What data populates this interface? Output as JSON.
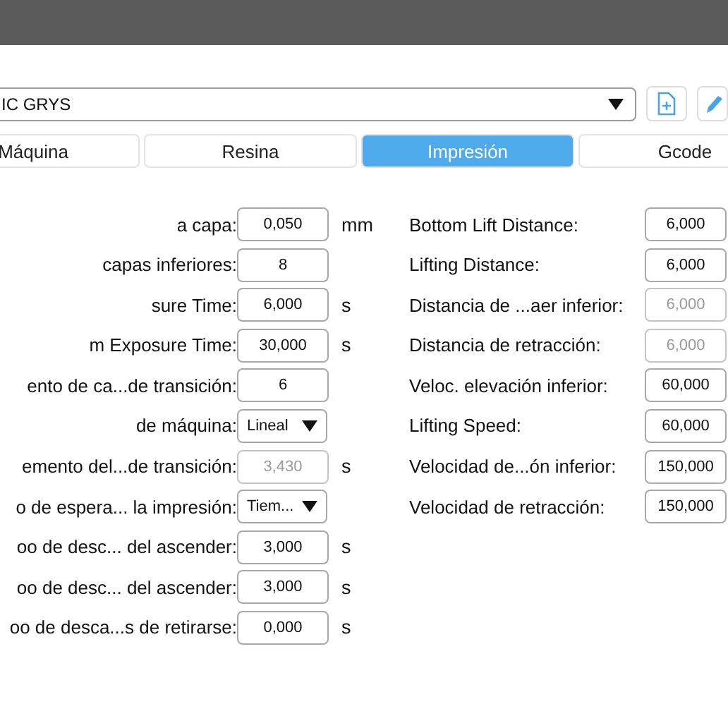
{
  "profile": {
    "value": "IC GRYS"
  },
  "tabs": [
    {
      "label": "Máquina",
      "selected": false
    },
    {
      "label": "Resina",
      "selected": false
    },
    {
      "label": "Impresión",
      "selected": true
    },
    {
      "label": "Gcode",
      "selected": false
    }
  ],
  "left_fields": [
    {
      "label": "a capa:",
      "kind": "input",
      "value": "0,050",
      "unit": "mm",
      "disabled": false
    },
    {
      "label": "capas inferiores:",
      "kind": "input",
      "value": "8",
      "disabled": false
    },
    {
      "label": "sure Time:",
      "kind": "input",
      "value": "6,000",
      "unit": "s",
      "disabled": false
    },
    {
      "label": "m Exposure Time:",
      "kind": "input",
      "value": "30,000",
      "unit": "s",
      "disabled": false
    },
    {
      "label": "ento de ca...de transición:",
      "kind": "input",
      "value": "6",
      "disabled": false
    },
    {
      "label": "de máquina:",
      "kind": "select",
      "value": "Lineal",
      "disabled": false
    },
    {
      "label": "emento del...de transición:",
      "kind": "input",
      "value": "3,430",
      "unit": "s",
      "disabled": true
    },
    {
      "label": "o de espera... la impresión:",
      "kind": "select",
      "value": "Tiem...",
      "disabled": false
    },
    {
      "label": "oo de desc... del ascender:",
      "kind": "input",
      "value": "3,000",
      "unit": "s",
      "disabled": false
    },
    {
      "label": "oo de desc... del ascender:",
      "kind": "input",
      "value": "3,000",
      "unit": "s",
      "disabled": false
    },
    {
      "label": "oo de desca...s de retirarse:",
      "kind": "input",
      "value": "0,000",
      "unit": "s",
      "disabled": false
    }
  ],
  "right_fields": [
    {
      "label": "Bottom Lift Distance:",
      "kind": "input",
      "value": "6,000",
      "disabled": false
    },
    {
      "label": "Lifting Distance:",
      "kind": "input",
      "value": "6,000",
      "disabled": false
    },
    {
      "label": "Distancia de ...aer inferior:",
      "kind": "input",
      "value": "6,000",
      "disabled": true
    },
    {
      "label": "Distancia de retracción:",
      "kind": "input",
      "value": "6,000",
      "disabled": true
    },
    {
      "label": "Veloc. elevación inferior:",
      "kind": "input",
      "value": "60,000",
      "disabled": false
    },
    {
      "label": "Lifting Speed:",
      "kind": "input",
      "value": "60,000",
      "disabled": false
    },
    {
      "label": "Velocidad de...ón inferior:",
      "kind": "input",
      "value": "150,000",
      "disabled": false
    },
    {
      "label": "Velocidad de retracción:",
      "kind": "input",
      "value": "150,000",
      "disabled": false
    }
  ]
}
